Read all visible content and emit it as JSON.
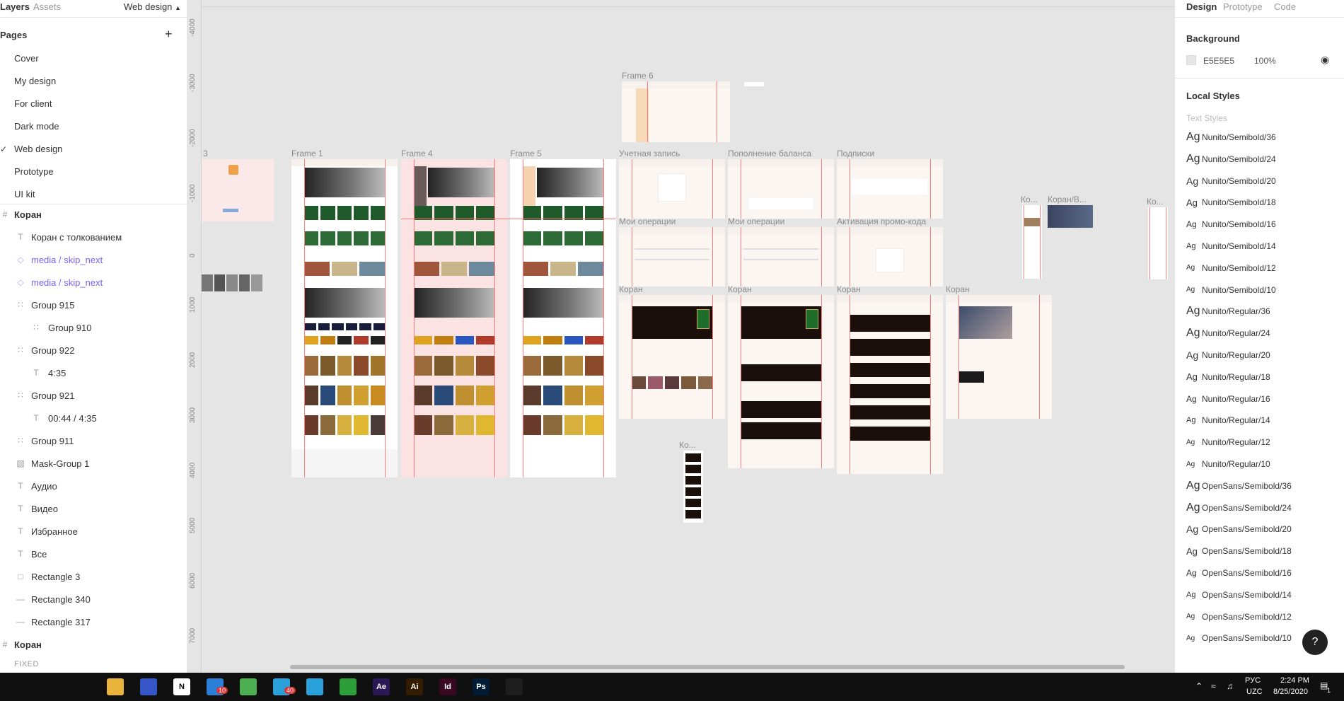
{
  "left_panel": {
    "tabs": [
      "Layers",
      "Assets"
    ],
    "current_page": "Web design",
    "pages_heading": "Pages",
    "pages": [
      "Cover",
      "My design",
      "For client",
      "Dark mode",
      "Web design",
      "Prototype",
      "UI kit"
    ],
    "layers": [
      {
        "name": "Коран",
        "icon": "frame-icon",
        "indent": 0,
        "bold": true,
        "purple": false
      },
      {
        "name": "Коран с толкованием",
        "icon": "text-icon",
        "indent": 1,
        "bold": false,
        "purple": false
      },
      {
        "name": "media / skip_next",
        "icon": "component-instance-icon",
        "indent": 1,
        "bold": false,
        "purple": true
      },
      {
        "name": "media / skip_next",
        "icon": "component-instance-icon",
        "indent": 1,
        "bold": false,
        "purple": true
      },
      {
        "name": "Group 915",
        "icon": "group-icon",
        "indent": 1,
        "bold": false,
        "purple": false
      },
      {
        "name": "Group 910",
        "icon": "group-icon",
        "indent": 2,
        "bold": false,
        "purple": false
      },
      {
        "name": "Group 922",
        "icon": "group-icon",
        "indent": 1,
        "bold": false,
        "purple": false
      },
      {
        "name": "4:35",
        "icon": "text-icon",
        "indent": 2,
        "bold": false,
        "purple": false
      },
      {
        "name": "Group 921",
        "icon": "group-icon",
        "indent": 1,
        "bold": false,
        "purple": false
      },
      {
        "name": "00:44 / 4:35",
        "icon": "text-icon",
        "indent": 2,
        "bold": false,
        "purple": false
      },
      {
        "name": "Group 911",
        "icon": "group-icon",
        "indent": 1,
        "bold": false,
        "purple": false
      },
      {
        "name": "Mask-Group 1",
        "icon": "image-icon",
        "indent": 1,
        "bold": false,
        "purple": false
      },
      {
        "name": "Аудио",
        "icon": "text-icon",
        "indent": 1,
        "bold": false,
        "purple": false
      },
      {
        "name": "Видео",
        "icon": "text-icon",
        "indent": 1,
        "bold": false,
        "purple": false
      },
      {
        "name": "Избранное",
        "icon": "text-icon",
        "indent": 1,
        "bold": false,
        "purple": false
      },
      {
        "name": "Все",
        "icon": "text-icon",
        "indent": 1,
        "bold": false,
        "purple": false
      },
      {
        "name": "Rectangle 3",
        "icon": "rectangle-icon",
        "indent": 1,
        "bold": false,
        "purple": false
      },
      {
        "name": "Rectangle 340",
        "icon": "line-icon",
        "indent": 1,
        "bold": false,
        "purple": false
      },
      {
        "name": "Rectangle 317",
        "icon": "line-icon",
        "indent": 1,
        "bold": false,
        "purple": false
      },
      {
        "name": "Коран",
        "icon": "frame-icon",
        "indent": 0,
        "bold": true,
        "purple": false
      }
    ],
    "fixed_label": "FIXED"
  },
  "canvas": {
    "ruler_ticks": [
      "-4000",
      "-3000",
      "-2000",
      "-1000",
      "0",
      "1000",
      "2000",
      "3000",
      "4000",
      "5000",
      "6000",
      "7000"
    ],
    "frame_labels": {
      "frame6": "Frame 6",
      "frame3": "3",
      "frame1": "Frame 1",
      "frame4": "Frame 4",
      "frame5": "Frame 5",
      "account": "Учетная запись",
      "topup": "Пополнение баланса",
      "subs": "Подписки",
      "ops1": "Мои операции",
      "ops2": "Мои операции",
      "promo": "Активация промо-кода",
      "quran1": "Коран",
      "quran2": "Коран",
      "quran3": "Коран",
      "quran4": "Коран",
      "ko1": "Ко...",
      "ko2": "Ко...",
      "ko3": "Ко...",
      "koranv": "Коран/В..."
    }
  },
  "right_panel": {
    "tabs": [
      "Design",
      "Prototype",
      "Code"
    ],
    "background_heading": "Background",
    "background_hex": "E5E5E5",
    "background_opacity": "100%",
    "local_styles_heading": "Local Styles",
    "text_styles_label": "Text Styles",
    "styles": [
      "Nunito/Semibold/36",
      "Nunito/Semibold/24",
      "Nunito/Semibold/20",
      "Nunito/Semibold/18",
      "Nunito/Semibold/16",
      "Nunito/Semibold/14",
      "Nunito/Semibold/12",
      "Nunito/Semibold/10",
      "Nunito/Regular/36",
      "Nunito/Regular/24",
      "Nunito/Regular/20",
      "Nunito/Regular/18",
      "Nunito/Regular/16",
      "Nunito/Regular/14",
      "Nunito/Regular/12",
      "Nunito/Regular/10",
      "OpenSans/Semibold/36",
      "OpenSans/Semibold/24",
      "OpenSans/Semibold/20",
      "OpenSans/Semibold/18",
      "OpenSans/Semibold/16",
      "OpenSans/Semibold/14",
      "OpenSans/Semibold/12",
      "OpenSans/Semibold/10"
    ],
    "style_glyph": "Ag",
    "help_glyph": "?"
  },
  "taskbar": {
    "apps": [
      {
        "name": "start-icon",
        "label": "",
        "color": "#101010"
      },
      {
        "name": "search-icon",
        "label": "",
        "color": "#101010"
      },
      {
        "name": "task-view-icon",
        "label": "",
        "color": "#101010"
      },
      {
        "name": "file-explorer-icon",
        "label": "",
        "color": "#e8b53a"
      },
      {
        "name": "save-icon",
        "label": "",
        "color": "#3555c8"
      },
      {
        "name": "notion-icon",
        "label": "N",
        "color": "#ffffff"
      },
      {
        "name": "todo-icon",
        "label": "",
        "color": "#2b7fd6"
      },
      {
        "name": "chrome-icon",
        "label": "",
        "color": "#4caf50"
      },
      {
        "name": "telegram-icon",
        "label": "",
        "color": "#2aa1da"
      },
      {
        "name": "telegram2-icon",
        "label": "",
        "color": "#2aa1da"
      },
      {
        "name": "camtasia-icon",
        "label": "",
        "color": "#2e9e3b"
      },
      {
        "name": "after-effects-icon",
        "label": "Ae",
        "color": "#2a1857"
      },
      {
        "name": "illustrator-icon",
        "label": "Ai",
        "color": "#331c00"
      },
      {
        "name": "indesign-icon",
        "label": "Id",
        "color": "#3a0820"
      },
      {
        "name": "photoshop-icon",
        "label": "Ps",
        "color": "#001d35"
      },
      {
        "name": "figma-icon",
        "label": "",
        "color": "#1e1e1e"
      }
    ],
    "badge_todo": "10",
    "badge_telegram": "40",
    "lang": "РУС",
    "lang2": "UZC",
    "time": "2:24 PM",
    "date": "8/25/2020",
    "notif_count": "1"
  }
}
